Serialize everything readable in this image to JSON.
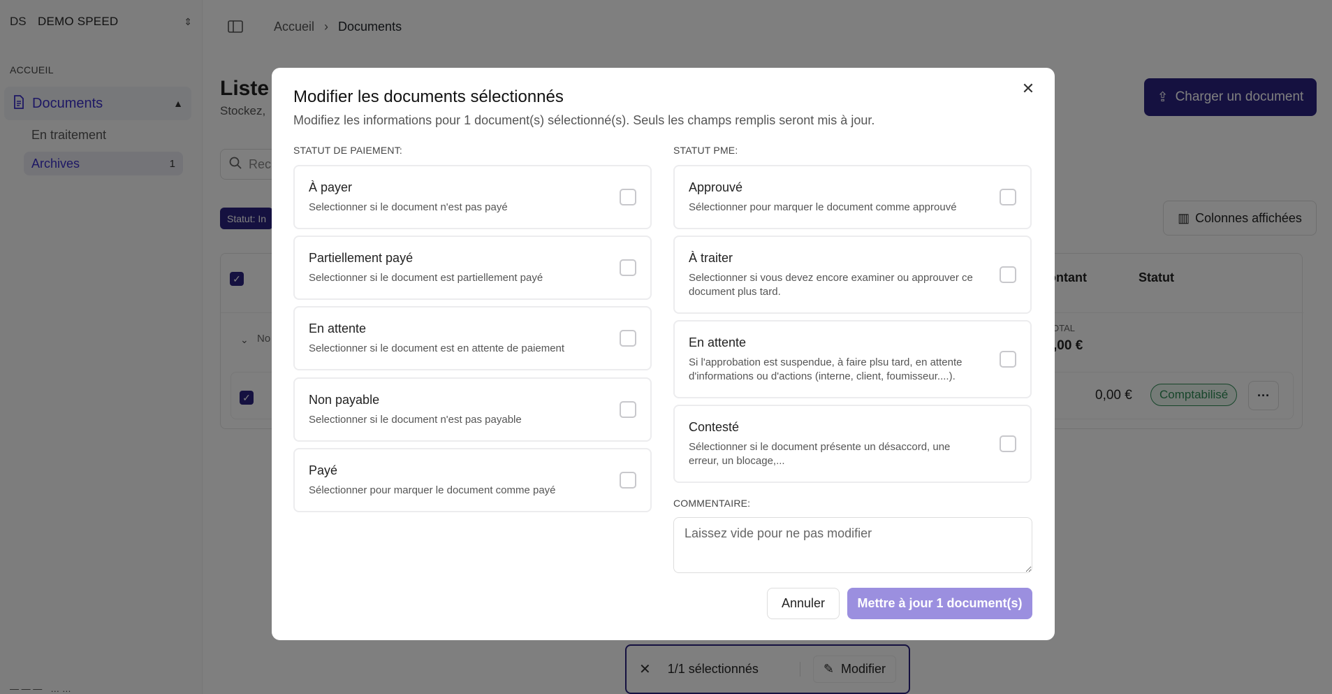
{
  "workspace": {
    "initials": "DS",
    "name": "DEMO SPEED"
  },
  "sidebar": {
    "section": "ACCUEIL",
    "documents_label": "Documents",
    "sub_items": [
      {
        "label": "En traitement"
      },
      {
        "label": "Archives",
        "count": "1"
      }
    ],
    "user_initials": "— — —",
    "user_email": "… …"
  },
  "breadcrumb": {
    "home": "Accueil",
    "current": "Documents"
  },
  "page": {
    "title": "Liste",
    "subtitle": "Stockez,",
    "upload_button": "Charger un document",
    "search_placeholder": "Rech",
    "filter_chip": "Statut: In",
    "columns_button": "Colonnes affichées"
  },
  "table": {
    "col_amount": "ontant",
    "col_status": "Statut",
    "group_prefix": "No",
    "total_label": "OTAL",
    "total_value": ",00 €",
    "row": {
      "amount": "0,00 €",
      "status": "Comptabilisé"
    }
  },
  "selection_bar": {
    "text": "1/1 sélectionnés",
    "modify": "Modifier"
  },
  "modal": {
    "title": "Modifier les documents sélectionnés",
    "description": "Modifiez les informations pour 1 document(s) sélectionné(s). Seuls les champs remplis seront mis à jour.",
    "payment_label": "STATUT DE PAIEMENT:",
    "payment_options": [
      {
        "title": "À payer",
        "desc": "Selectionner si le document n'est pas payé"
      },
      {
        "title": "Partiellement payé",
        "desc": "Selectionner si le document est partiellement payé"
      },
      {
        "title": "En attente",
        "desc": "Selectionner si le document est en attente de paiement"
      },
      {
        "title": "Non payable",
        "desc": "Selectionner si le document n'est pas payable"
      },
      {
        "title": "Payé",
        "desc": "Sélectionner pour marquer le document comme payé"
      }
    ],
    "pme_label": "STATUT PME:",
    "pme_options": [
      {
        "title": "Approuvé",
        "desc": "Sélectionner pour marquer le document comme approuvé"
      },
      {
        "title": "À traiter",
        "desc": "Selectionner si vous devez encore examiner ou approuver ce document plus tard."
      },
      {
        "title": "En attente",
        "desc": "Si l'approbation est suspendue, à faire plsu tard, en attente d'informations ou d'actions (interne, client, foumisseur....)."
      },
      {
        "title": "Contesté",
        "desc": "Sélectionner si le document présente un désaccord, une erreur, un blocage,..."
      }
    ],
    "comment_label": "COMMENTAIRE:",
    "comment_placeholder": "Laissez vide pour ne pas modifier",
    "cancel": "Annuler",
    "submit": "Mettre à jour 1 document(s)"
  },
  "colors": {
    "brand": "#2a2280",
    "submit": "#9b8fdf",
    "status_green": "#2f8a55"
  }
}
